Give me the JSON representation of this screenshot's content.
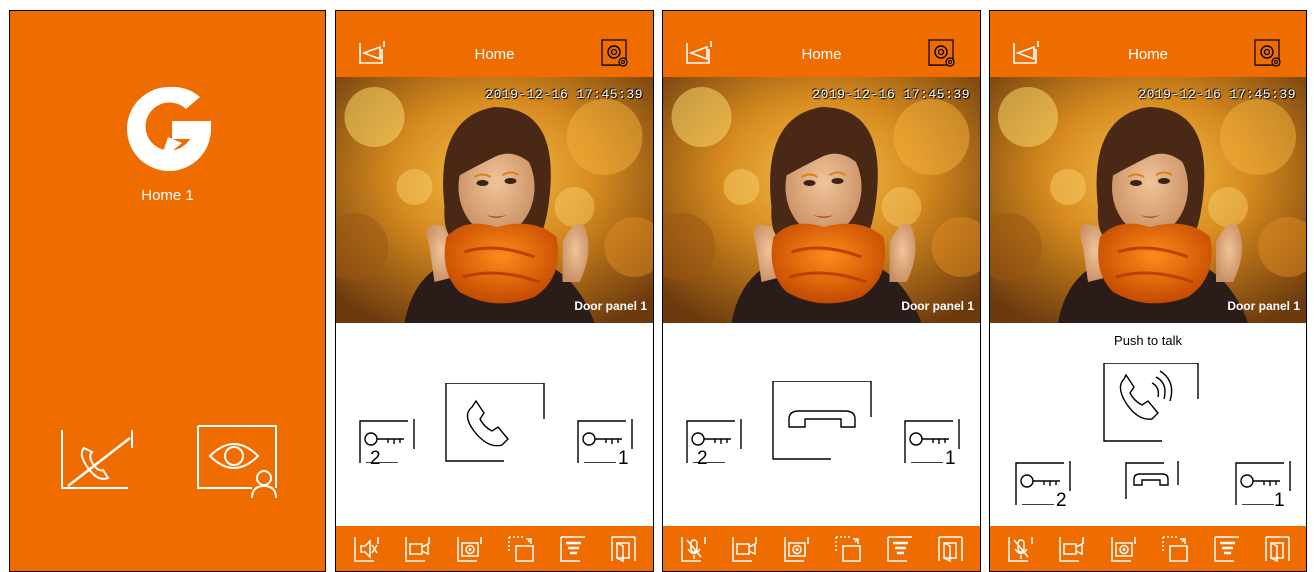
{
  "colors": {
    "accent": "#ef6c00",
    "text_dark": "#000000",
    "text_light": "#ffffff"
  },
  "screen1": {
    "label": "Home 1",
    "icons": [
      "logo-icon",
      "no-call-icon",
      "view-camera-icon"
    ]
  },
  "screens": [
    {
      "title": "Home",
      "timestamp": "2019-12-16  17:45:39",
      "door_label": "Door panel 1",
      "call_state": "incoming",
      "key_left_num": "2",
      "key_right_num": "1",
      "footer_icons": [
        "mute-icon",
        "video-icon",
        "camera-capture-icon",
        "switch-camera-icon",
        "menu-icon",
        "door-icon"
      ]
    },
    {
      "title": "Home",
      "timestamp": "2019-12-16  17:45:39",
      "door_label": "Door panel 1",
      "call_state": "in-call",
      "key_left_num": "2",
      "key_right_num": "1",
      "footer_icons": [
        "mic-off-icon",
        "video-icon",
        "camera-capture-icon",
        "switch-camera-icon",
        "menu-icon",
        "door-icon"
      ]
    },
    {
      "title": "Home",
      "timestamp": "2019-12-16  17:45:39",
      "door_label": "Door panel 1",
      "push_label": "Push to talk",
      "call_state": "push-to-talk",
      "key_left_num": "2",
      "key_right_num": "1",
      "footer_icons": [
        "mic-off-icon",
        "video-icon",
        "camera-capture-icon",
        "switch-camera-icon",
        "menu-icon",
        "door-icon"
      ]
    }
  ]
}
